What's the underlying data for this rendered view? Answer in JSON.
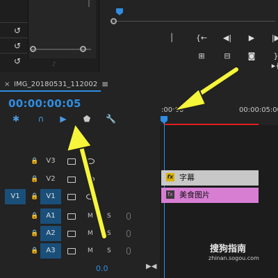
{
  "timeline": {
    "tab_close": "×",
    "sequence_name": "IMG_20180531_112002",
    "menu_icon": "≡",
    "timecode": "00:00:00:05",
    "ruler_start": ":00:00",
    "ruler_end": "00:00:05:00",
    "volume_value": "0.0"
  },
  "tracks": {
    "video": [
      {
        "label": "V3",
        "source": ""
      },
      {
        "label": "V2",
        "source": ""
      },
      {
        "label": "V1",
        "source": "V1"
      }
    ],
    "audio": [
      {
        "label": "A1",
        "m": "M",
        "s": "S"
      },
      {
        "label": "A2",
        "m": "M",
        "s": "S"
      },
      {
        "label": "A3",
        "m": "M",
        "s": "S"
      }
    ]
  },
  "clips": {
    "title_clip": "字幕",
    "video_clip": "美食图片",
    "title_badge": "fx",
    "video_badge": "fx"
  },
  "watermark": {
    "brand": "搜狗指南",
    "url": "zhinan.sogou.com"
  },
  "colors": {
    "accent_blue": "#2f8ee3",
    "playhead": "#2f8ee3",
    "arrow": "#f5f53a",
    "video_clip": "#d77ed3",
    "title_clip": "#c8c8c8",
    "work_area": "#e02020"
  }
}
